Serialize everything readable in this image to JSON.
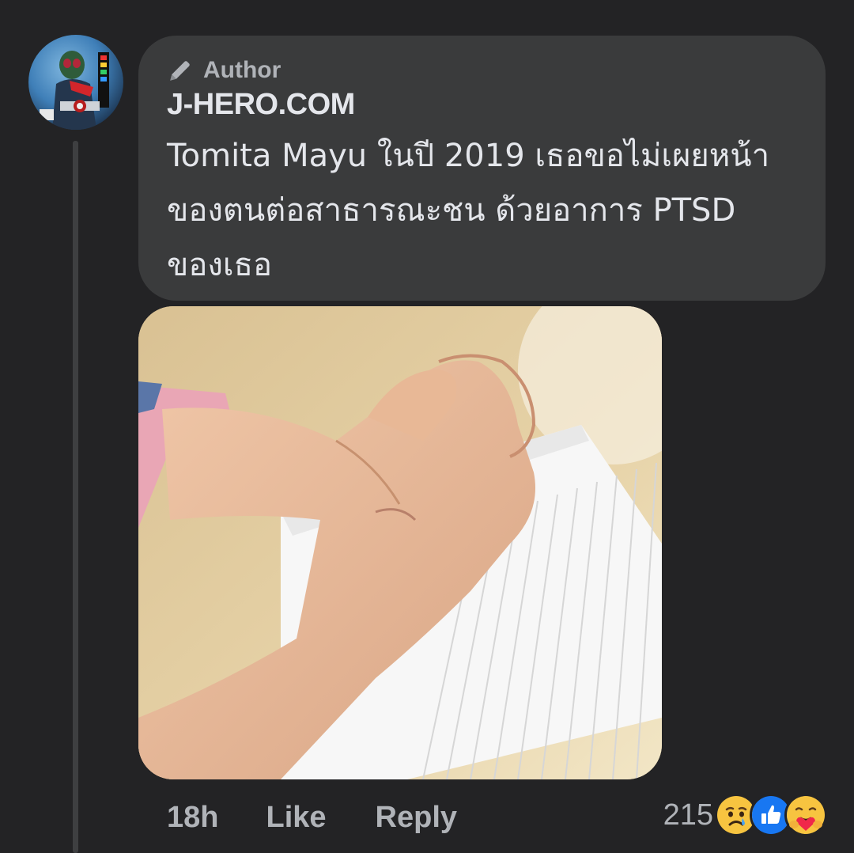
{
  "comment": {
    "badge_label": "Author",
    "author_name": "J-HERO.COM",
    "text": "Tomita Mayu ในปี 2019 เธอขอไม่เผยหน้าของตนต่อสาธารณะชน ด้วยอาการ PTSD ของเธอ",
    "timestamp": "18h",
    "like_label": "Like",
    "reply_label": "Reply",
    "reaction_count": "215",
    "reactions": [
      "sad-icon",
      "like-icon",
      "care-icon"
    ]
  },
  "colors": {
    "background": "#232325",
    "bubble": "#3a3b3c",
    "primary_text": "#e4e6eb",
    "secondary_text": "#b0b3b8",
    "like_blue": "#1877f2"
  }
}
